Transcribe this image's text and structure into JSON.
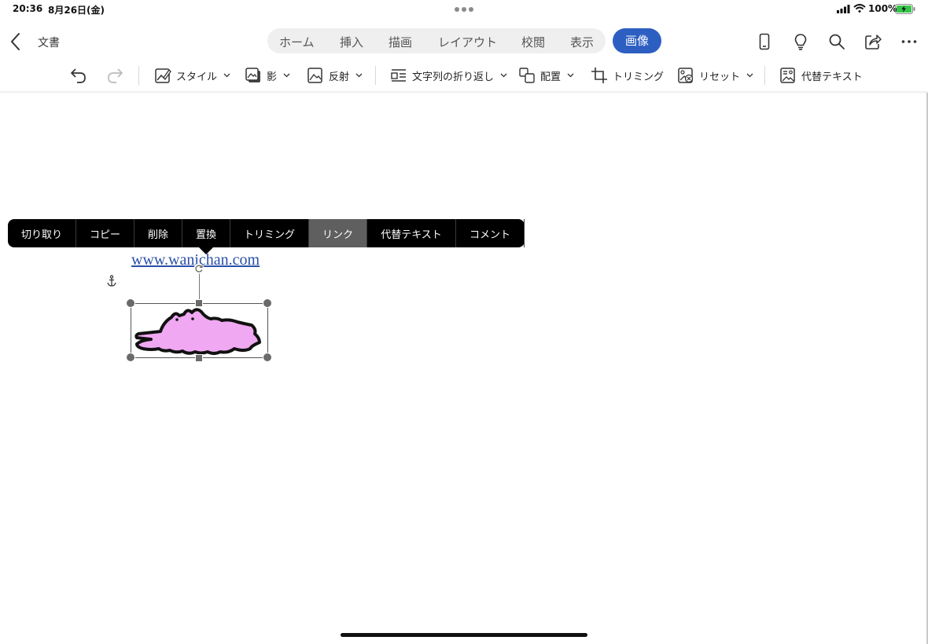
{
  "status_bar": {
    "time": "20:36",
    "date": "8月26日(金)",
    "battery_percent": "100%"
  },
  "nav": {
    "back_icon": "chevron-left-icon",
    "doc_title": "文書",
    "tabs": [
      {
        "label": "ホーム"
      },
      {
        "label": "挿入"
      },
      {
        "label": "描画"
      },
      {
        "label": "レイアウト"
      },
      {
        "label": "校閲"
      },
      {
        "label": "表示"
      }
    ],
    "active_tab": "画像",
    "active_tab_color": "#2d5fc2",
    "right_icons": [
      "phone-icon",
      "lightbulb-icon",
      "search-icon",
      "share-icon",
      "more-icon"
    ]
  },
  "ribbon": {
    "style_label": "スタイル",
    "shadow_label": "影",
    "reflection_label": "反射",
    "wrap_label": "文字列の折り返し",
    "arrange_label": "配置",
    "crop_label": "トリミング",
    "reset_label": "リセット",
    "alt_text_label": "代替テキスト"
  },
  "context_menu": {
    "items": [
      {
        "label": "切り取り"
      },
      {
        "label": "コピー"
      },
      {
        "label": "削除"
      },
      {
        "label": "置換"
      },
      {
        "label": "トリミング"
      },
      {
        "label": "リンク"
      },
      {
        "label": "代替テキスト"
      },
      {
        "label": "コメント"
      }
    ],
    "selected": "リンク"
  },
  "document": {
    "link_text": "www.wanichan.com",
    "image_fill_color": "#f0a8f2"
  }
}
